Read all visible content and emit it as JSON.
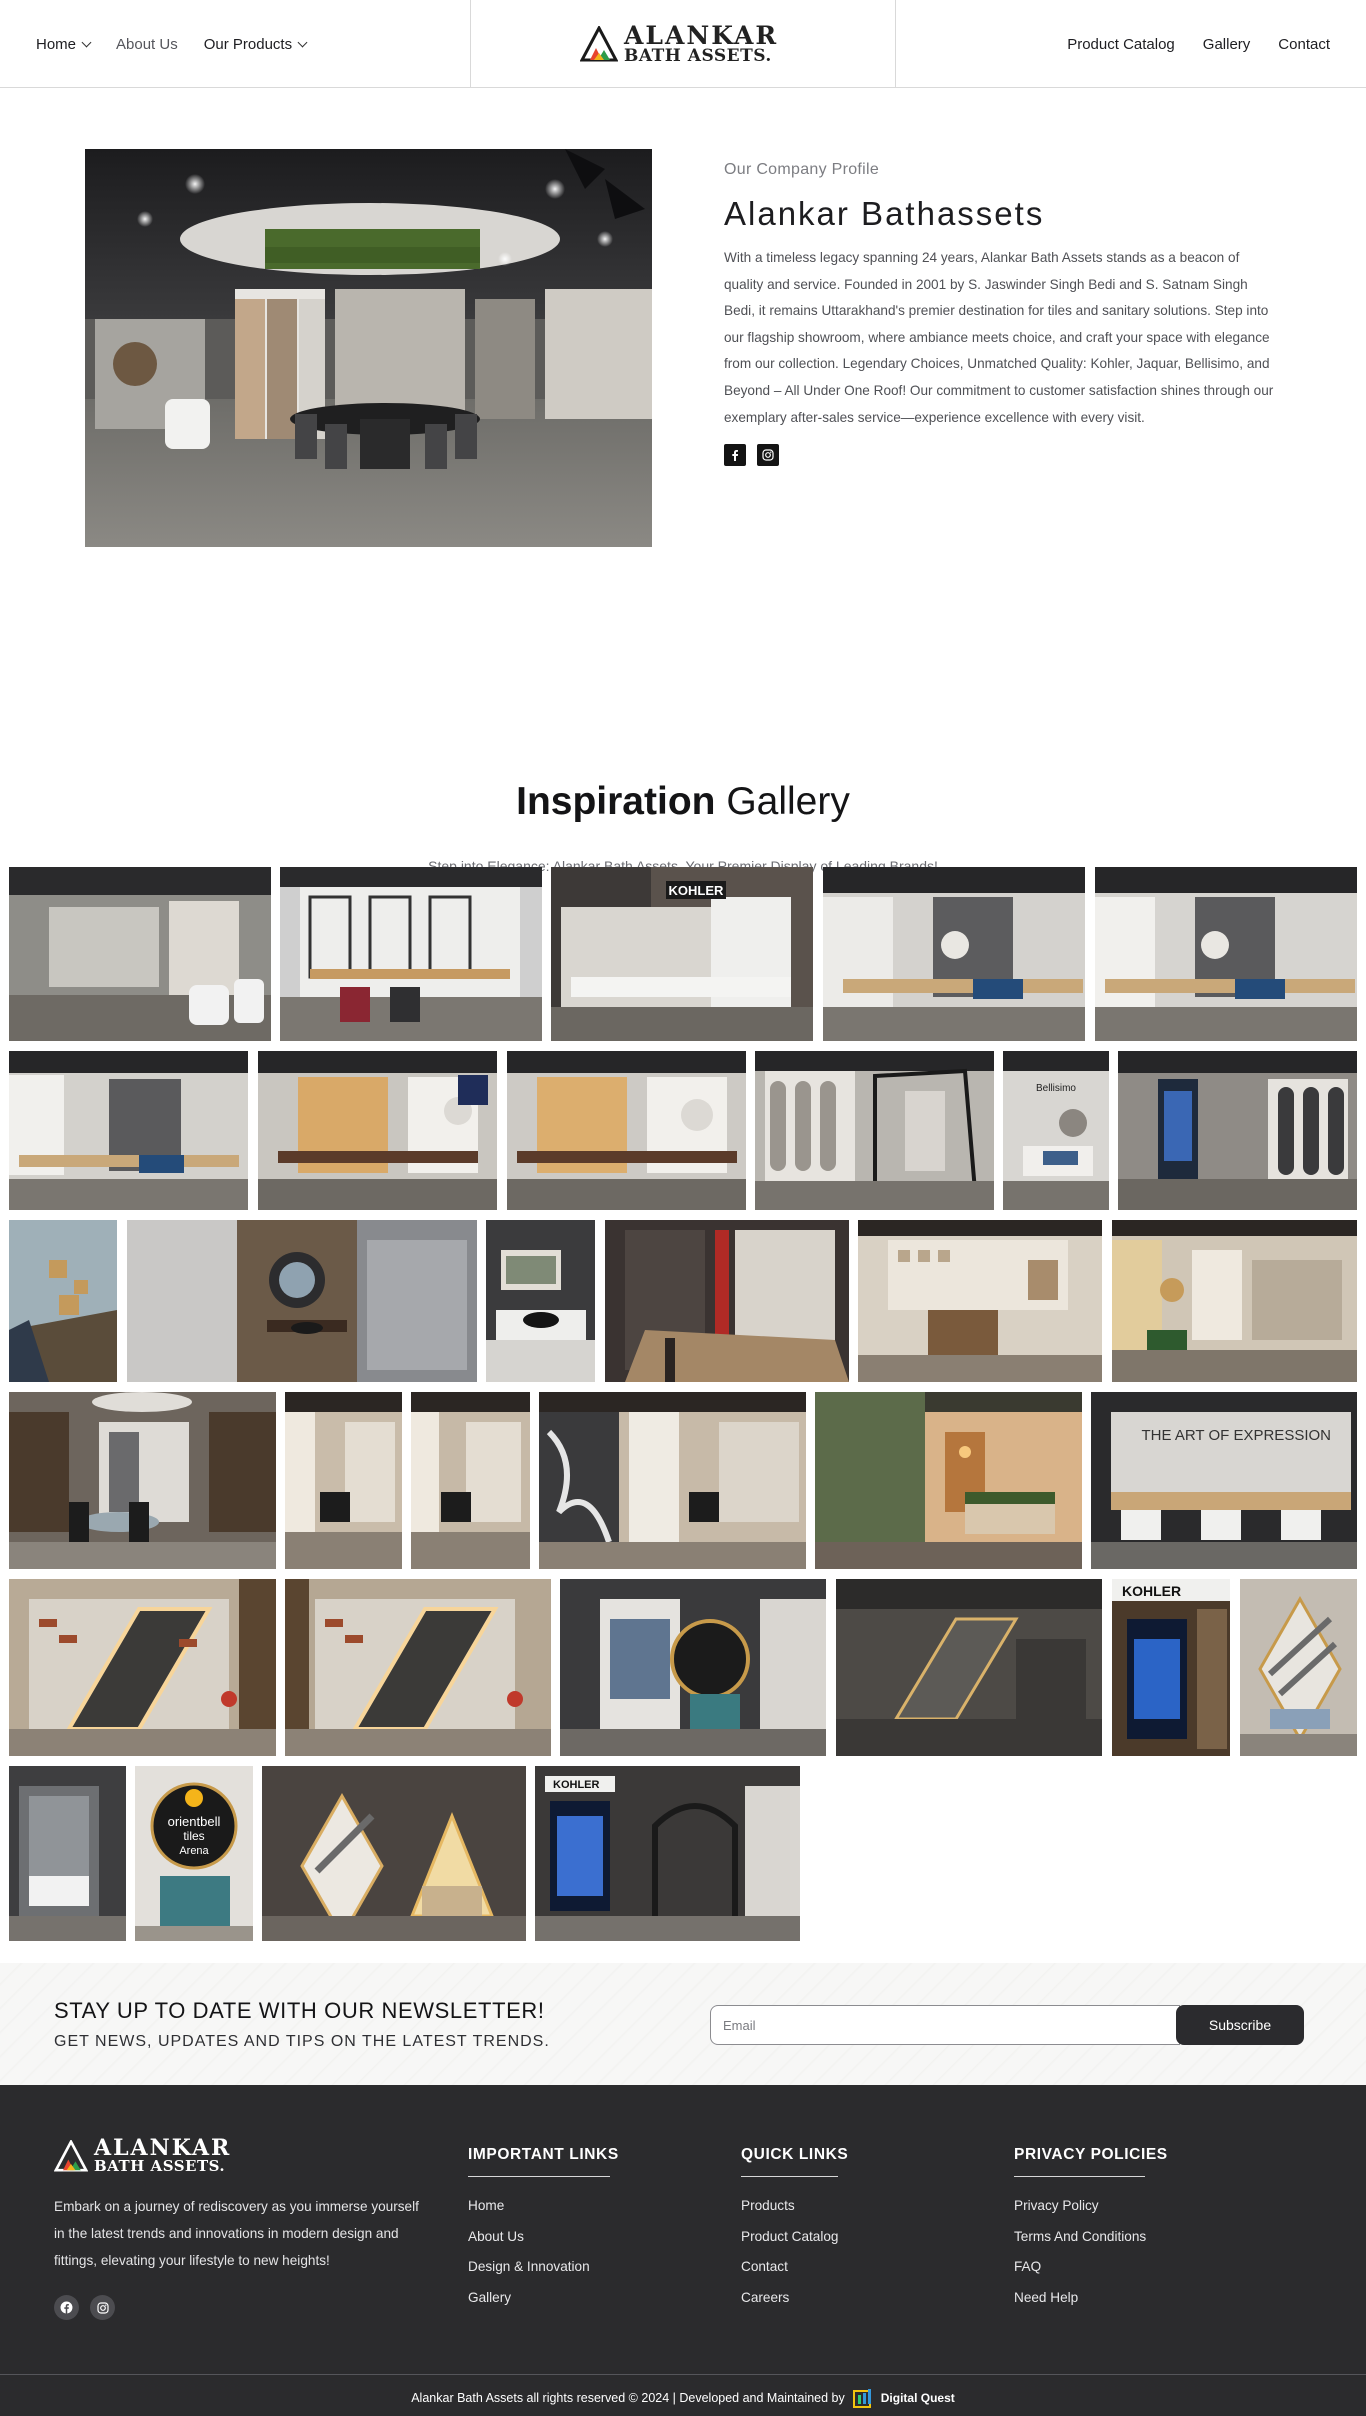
{
  "header": {
    "nav_left": [
      {
        "label": "Home",
        "has_dropdown": true
      },
      {
        "label": "About Us",
        "has_dropdown": false
      },
      {
        "label": "Our Products",
        "has_dropdown": true
      }
    ],
    "logo": {
      "line1": "ALANKAR",
      "line2": "BATH ASSETS."
    },
    "nav_right": [
      {
        "label": "Product Catalog"
      },
      {
        "label": "Gallery"
      },
      {
        "label": "Contact"
      }
    ]
  },
  "profile": {
    "eyebrow": "Our Company Profile",
    "title": "Alankar Bathassets",
    "description": "With a timeless legacy spanning 24 years, Alankar Bath Assets stands as a beacon of quality and service. Founded in 2001 by S. Jaswinder Singh Bedi and S. Satnam Singh Bedi, it remains Uttarakhand's premier destination for tiles and sanitary solutions. Step into our flagship showroom, where ambiance meets choice, and craft your space with elegance from our collection. Legendary Choices, Unmatched Quality: Kohler, Jaquar, Bellisimo, and Beyond – All Under One Roof! Our commitment to customer satisfaction shines through our exemplary after-sales service—experience excellence with every visit.",
    "socials": [
      "facebook-icon",
      "instagram-icon"
    ]
  },
  "gallery": {
    "title_bold": "Inspiration",
    "title_light": "Gallery",
    "subtitle": "Step into Elegance: Alankar Bath Assets, Your Premier Display of Leading Brands!",
    "sign_kohler": "KOHLER",
    "sign_bellisimo": "Bellisimo",
    "sign_art": "THE ART OF EXPRESSION",
    "sign_orientbell_1": "orientbell",
    "sign_orientbell_2": "tiles",
    "sign_orientbell_3": "Arena"
  },
  "newsletter": {
    "title": "STAY UP TO DATE WITH OUR NEWSLETTER!",
    "subtitle": "GET NEWS, UPDATES AND TIPS ON THE LATEST TRENDS.",
    "email_placeholder": "Email",
    "button": "Subscribe"
  },
  "footer": {
    "logo": {
      "line1": "ALANKAR",
      "line2": "BATH ASSETS."
    },
    "description": "Embark on a journey of rediscovery as you immerse yourself in the latest trends and innovations in modern design and fittings, elevating your lifestyle to new heights!",
    "socials": [
      "facebook-icon",
      "instagram-icon"
    ],
    "columns": [
      {
        "title": "IMPORTANT LINKS",
        "links": [
          "Home",
          "About Us",
          "Design & Innovation",
          "Gallery"
        ]
      },
      {
        "title": "QUICK LINKS",
        "links": [
          "Products",
          "Product Catalog",
          "Contact",
          "Careers"
        ]
      },
      {
        "title": "PRIVACY POLICIES",
        "links": [
          "Privacy Policy",
          "Terms And Conditions",
          "FAQ",
          "Need Help"
        ]
      }
    ],
    "copyright": "Alankar Bath Assets all rights reserved © 2024 | Developed and Maintained by",
    "developer": "Digital Quest"
  },
  "colors": {
    "footer_bg": "#2b2b2d",
    "button_bg": "#2b2b2e",
    "text_dark": "#1d1d20",
    "text_muted": "#4f5055"
  }
}
